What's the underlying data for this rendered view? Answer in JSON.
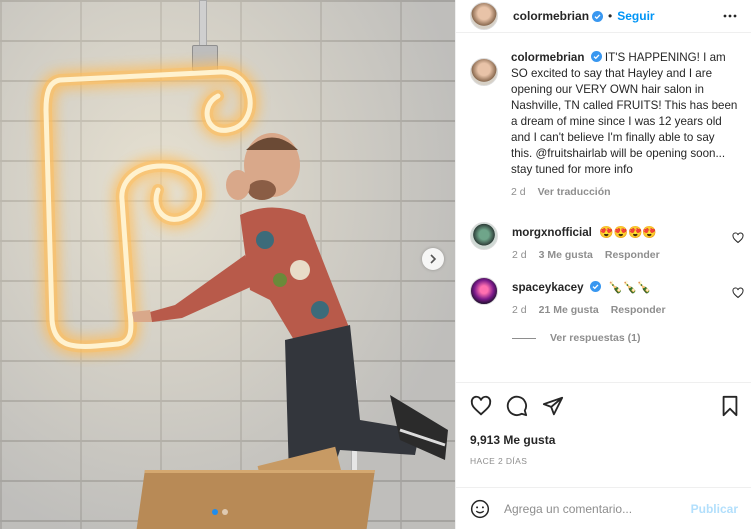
{
  "post": {
    "author": "colormebrian",
    "follow_label": "Seguir",
    "separator": "•"
  },
  "caption": {
    "username": "colormebrian",
    "text": "IT'S HAPPENING! I am SO excited to say that Hayley and I are opening our VERY OWN hair salon in Nashville, TN called FRUITS! This has been a dream of mine since I was 12 years old and I can't believe I'm finally able to say this. @fruitshairlab will be opening soon... stay tuned for more info",
    "age": "2 d",
    "translate_label": "Ver traducción"
  },
  "comments": [
    {
      "username": "morgxnofficial",
      "text": "😍😍😍😍",
      "age": "2 d",
      "likes": "3 Me gusta",
      "reply_label": "Responder"
    },
    {
      "username": "spaceykacey",
      "text": "🍾🍾🍾",
      "age": "2 d",
      "likes": "21 Me gusta",
      "reply_label": "Responder"
    }
  ],
  "view_replies_label": "Ver respuestas (1)",
  "stats": {
    "likes": "9,913 Me gusta",
    "date": "HACE 2 DÍAS"
  },
  "composer": {
    "placeholder": "Agrega un comentario...",
    "publish_label": "Publicar"
  },
  "carousel": {
    "slide_count": 2,
    "active_slide": 1
  },
  "icons": [
    "more-icon",
    "heart-icon",
    "comment-icon",
    "share-icon",
    "save-icon",
    "emoji-icon",
    "chevron-right-icon",
    "verified-icon"
  ],
  "colors": {
    "accent": "#0095f6",
    "verified": "#3897f0",
    "publish_disabled": "#b2dffc",
    "neon": "#ffd68a"
  }
}
